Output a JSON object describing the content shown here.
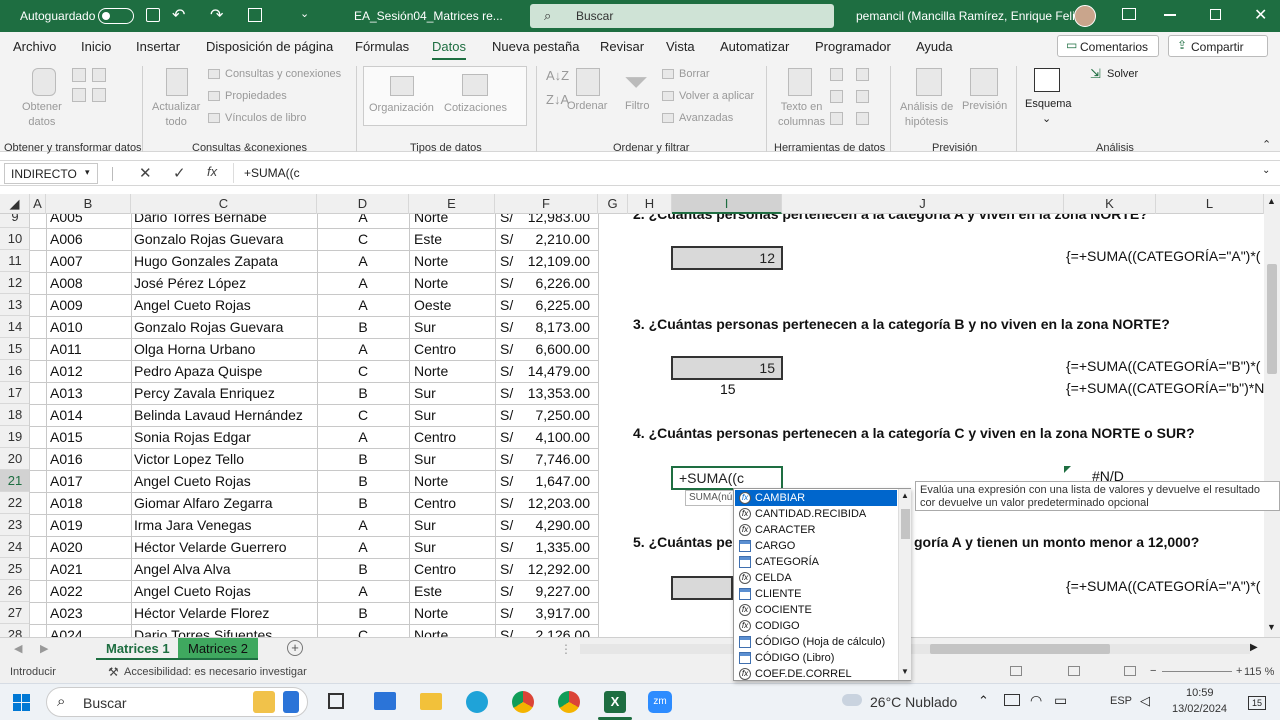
{
  "titlebar": {
    "autosave_label": "Autoguardado",
    "file_name": "EA_Sesión04_Matrices re...",
    "search_placeholder": "Buscar",
    "user_name": "pemancil (Mancilla Ramírez, Enrique Felix)"
  },
  "ribbon_tabs": [
    "Archivo",
    "Inicio",
    "Insertar",
    "Disposición de página",
    "Fórmulas",
    "Datos",
    "Nueva pestaña",
    "Revisar",
    "Vista",
    "Automatizar",
    "Programador",
    "Ayuda"
  ],
  "active_tab": "Datos",
  "ribbon_actions": {
    "comments": "Comentarios",
    "share": "Compartir"
  },
  "ribbon": {
    "obtener_datos": "Obtener\ndatos",
    "consultas": "Consultas y conexiones",
    "propiedades": "Propiedades",
    "vinculos": "Vínculos de libro",
    "actualizar": "Actualizar\ntodo",
    "organizacion": "Organización",
    "cotizaciones": "Cotizaciones",
    "ordenar": "Ordenar",
    "filtro": "Filtro",
    "borrar": "Borrar",
    "volver_aplicar": "Volver a aplicar",
    "avanzadas": "Avanzadas",
    "texto_columnas": "Texto en\ncolumnas",
    "analisis_hipotesis": "Análisis de\nhipótesis",
    "prevision_btn": "Previsión",
    "esquema": "Esquema",
    "solver": "Solver",
    "groups": [
      "Obtener y transformar datos",
      "Consultas &conexiones",
      "Tipos de datos",
      "Ordenar y filtrar",
      "Herramientas de datos",
      "Previsión",
      "Análisis"
    ]
  },
  "formula_bar": {
    "name_box": "INDIRECTO",
    "formula": "+SUMA((c"
  },
  "columns": [
    "A",
    "B",
    "C",
    "D",
    "E",
    "F",
    "G",
    "H",
    "I",
    "J",
    "K",
    "L"
  ],
  "selected_column": "I",
  "rows": [
    {
      "n": "9",
      "code": "A005",
      "name": "Dario Torres Bernabé",
      "cat": "A",
      "zone": "Norte",
      "cur": "S/",
      "amount": "12,983.00"
    },
    {
      "n": "10",
      "code": "A006",
      "name": "Gonzalo Rojas Guevara",
      "cat": "C",
      "zone": "Este",
      "cur": "S/",
      "amount": "2,210.00"
    },
    {
      "n": "11",
      "code": "A007",
      "name": "Hugo Gonzales Zapata",
      "cat": "A",
      "zone": "Norte",
      "cur": "S/",
      "amount": "12,109.00"
    },
    {
      "n": "12",
      "code": "A008",
      "name": "José Pérez López",
      "cat": "A",
      "zone": "Norte",
      "cur": "S/",
      "amount": "6,226.00"
    },
    {
      "n": "13",
      "code": "A009",
      "name": "Angel Cueto Rojas",
      "cat": "A",
      "zone": "Oeste",
      "cur": "S/",
      "amount": "6,225.00"
    },
    {
      "n": "14",
      "code": "A010",
      "name": "Gonzalo Rojas Guevara",
      "cat": "B",
      "zone": "Sur",
      "cur": "S/",
      "amount": "8,173.00"
    },
    {
      "n": "15",
      "code": "A011",
      "name": "Olga Horna Urbano",
      "cat": "A",
      "zone": "Centro",
      "cur": "S/",
      "amount": "6,600.00"
    },
    {
      "n": "16",
      "code": "A012",
      "name": "Pedro Apaza Quispe",
      "cat": "C",
      "zone": "Norte",
      "cur": "S/",
      "amount": "14,479.00"
    },
    {
      "n": "17",
      "code": "A013",
      "name": "Percy Zavala Enriquez",
      "cat": "B",
      "zone": "Sur",
      "cur": "S/",
      "amount": "13,353.00"
    },
    {
      "n": "18",
      "code": "A014",
      "name": "Belinda Lavaud Hernández",
      "cat": "C",
      "zone": "Sur",
      "cur": "S/",
      "amount": "7,250.00"
    },
    {
      "n": "19",
      "code": "A015",
      "name": "Sonia Rojas Edgar",
      "cat": "A",
      "zone": "Centro",
      "cur": "S/",
      "amount": "4,100.00"
    },
    {
      "n": "20",
      "code": "A016",
      "name": "Victor Lopez Tello",
      "cat": "B",
      "zone": "Sur",
      "cur": "S/",
      "amount": "7,746.00"
    },
    {
      "n": "21",
      "code": "A017",
      "name": "Angel Cueto Rojas",
      "cat": "B",
      "zone": "Norte",
      "cur": "S/",
      "amount": "1,647.00"
    },
    {
      "n": "22",
      "code": "A018",
      "name": "Giomar Alfaro Zegarra",
      "cat": "B",
      "zone": "Centro",
      "cur": "S/",
      "amount": "12,203.00"
    },
    {
      "n": "23",
      "code": "A019",
      "name": "Irma Jara Venegas",
      "cat": "A",
      "zone": "Sur",
      "cur": "S/",
      "amount": "4,290.00"
    },
    {
      "n": "24",
      "code": "A020",
      "name": "Héctor Velarde Guerrero",
      "cat": "A",
      "zone": "Sur",
      "cur": "S/",
      "amount": "1,335.00"
    },
    {
      "n": "25",
      "code": "A021",
      "name": "Angel Alva Alva",
      "cat": "B",
      "zone": "Centro",
      "cur": "S/",
      "amount": "12,292.00"
    },
    {
      "n": "26",
      "code": "A022",
      "name": "Angel Cueto Rojas",
      "cat": "A",
      "zone": "Este",
      "cur": "S/",
      "amount": "9,227.00"
    },
    {
      "n": "27",
      "code": "A023",
      "name": "Héctor Velarde Florez",
      "cat": "B",
      "zone": "Norte",
      "cur": "S/",
      "amount": "3,917.00"
    },
    {
      "n": "28",
      "code": "A024",
      "name": "Dario Torres Sifuentes",
      "cat": "C",
      "zone": "Norte",
      "cur": "S/",
      "amount": "2,126.00"
    }
  ],
  "questions": {
    "q2": "2. ¿Cuántas personas pertenecen a la categoría A y viven en la zona NORTE?",
    "q3": "3. ¿Cuántas personas pertenecen a la categoría B y no viven en la zona NORTE?",
    "q4": "4. ¿Cuántas personas pertenecen a la categoría C y viven en la zona NORTE o SUR?",
    "q5": "5. ¿Cuántas per",
    "q5_tail": "goría A y tienen un monto menor a 12,000?"
  },
  "answers": {
    "a2": "12",
    "a3": "15",
    "a3b": "15",
    "editing": "+SUMA((c",
    "error": "#N/D"
  },
  "formulas": {
    "f2": "{=+SUMA((CATEGORÍA=\"A\")*(",
    "f3": "{=+SUMA((CATEGORÍA=\"B\")*(",
    "f3b": "{=+SUMA((CATEGORÍA=\"b\")*N",
    "f5": "{=+SUMA((CATEGORÍA=\"A\")*("
  },
  "tooltip_hint": "SUMA(nú",
  "autocomplete": [
    {
      "label": "CAMBIAR",
      "kind": "fx"
    },
    {
      "label": "CANTIDAD.RECIBIDA",
      "kind": "fx"
    },
    {
      "label": "CARACTER",
      "kind": "fx"
    },
    {
      "label": "CARGO",
      "kind": "tbl"
    },
    {
      "label": "CATEGORÍA",
      "kind": "tbl"
    },
    {
      "label": "CELDA",
      "kind": "fx"
    },
    {
      "label": "CLIENTE",
      "kind": "tbl"
    },
    {
      "label": "COCIENTE",
      "kind": "fx"
    },
    {
      "label": "CODIGO",
      "kind": "fx"
    },
    {
      "label": "CÓDIGO (Hoja de cálculo)",
      "kind": "tbl"
    },
    {
      "label": "CÓDIGO (Libro)",
      "kind": "tbl"
    },
    {
      "label": "COEF.DE.CORREL",
      "kind": "fx"
    }
  ],
  "func_tooltip": "Evalúa una expresión con una lista de valores y devuelve el resultado cor devuelve un valor predeterminado opcional",
  "sheets": [
    "Matrices 1",
    "Matrices 2"
  ],
  "active_sheet": "Matrices 2",
  "status": {
    "mode": "Introducir",
    "accessibility": "Accesibilidad: es necesario investigar",
    "zoom": "115 %"
  },
  "taskbar": {
    "search": "Buscar",
    "weather": "26°C  Nublado",
    "lang": "ESP",
    "time": "10:59",
    "date": "13/02/2024",
    "notif": "15"
  },
  "colors": {
    "excel_green": "#1e6e41",
    "selection_blue": "#0066cc"
  }
}
